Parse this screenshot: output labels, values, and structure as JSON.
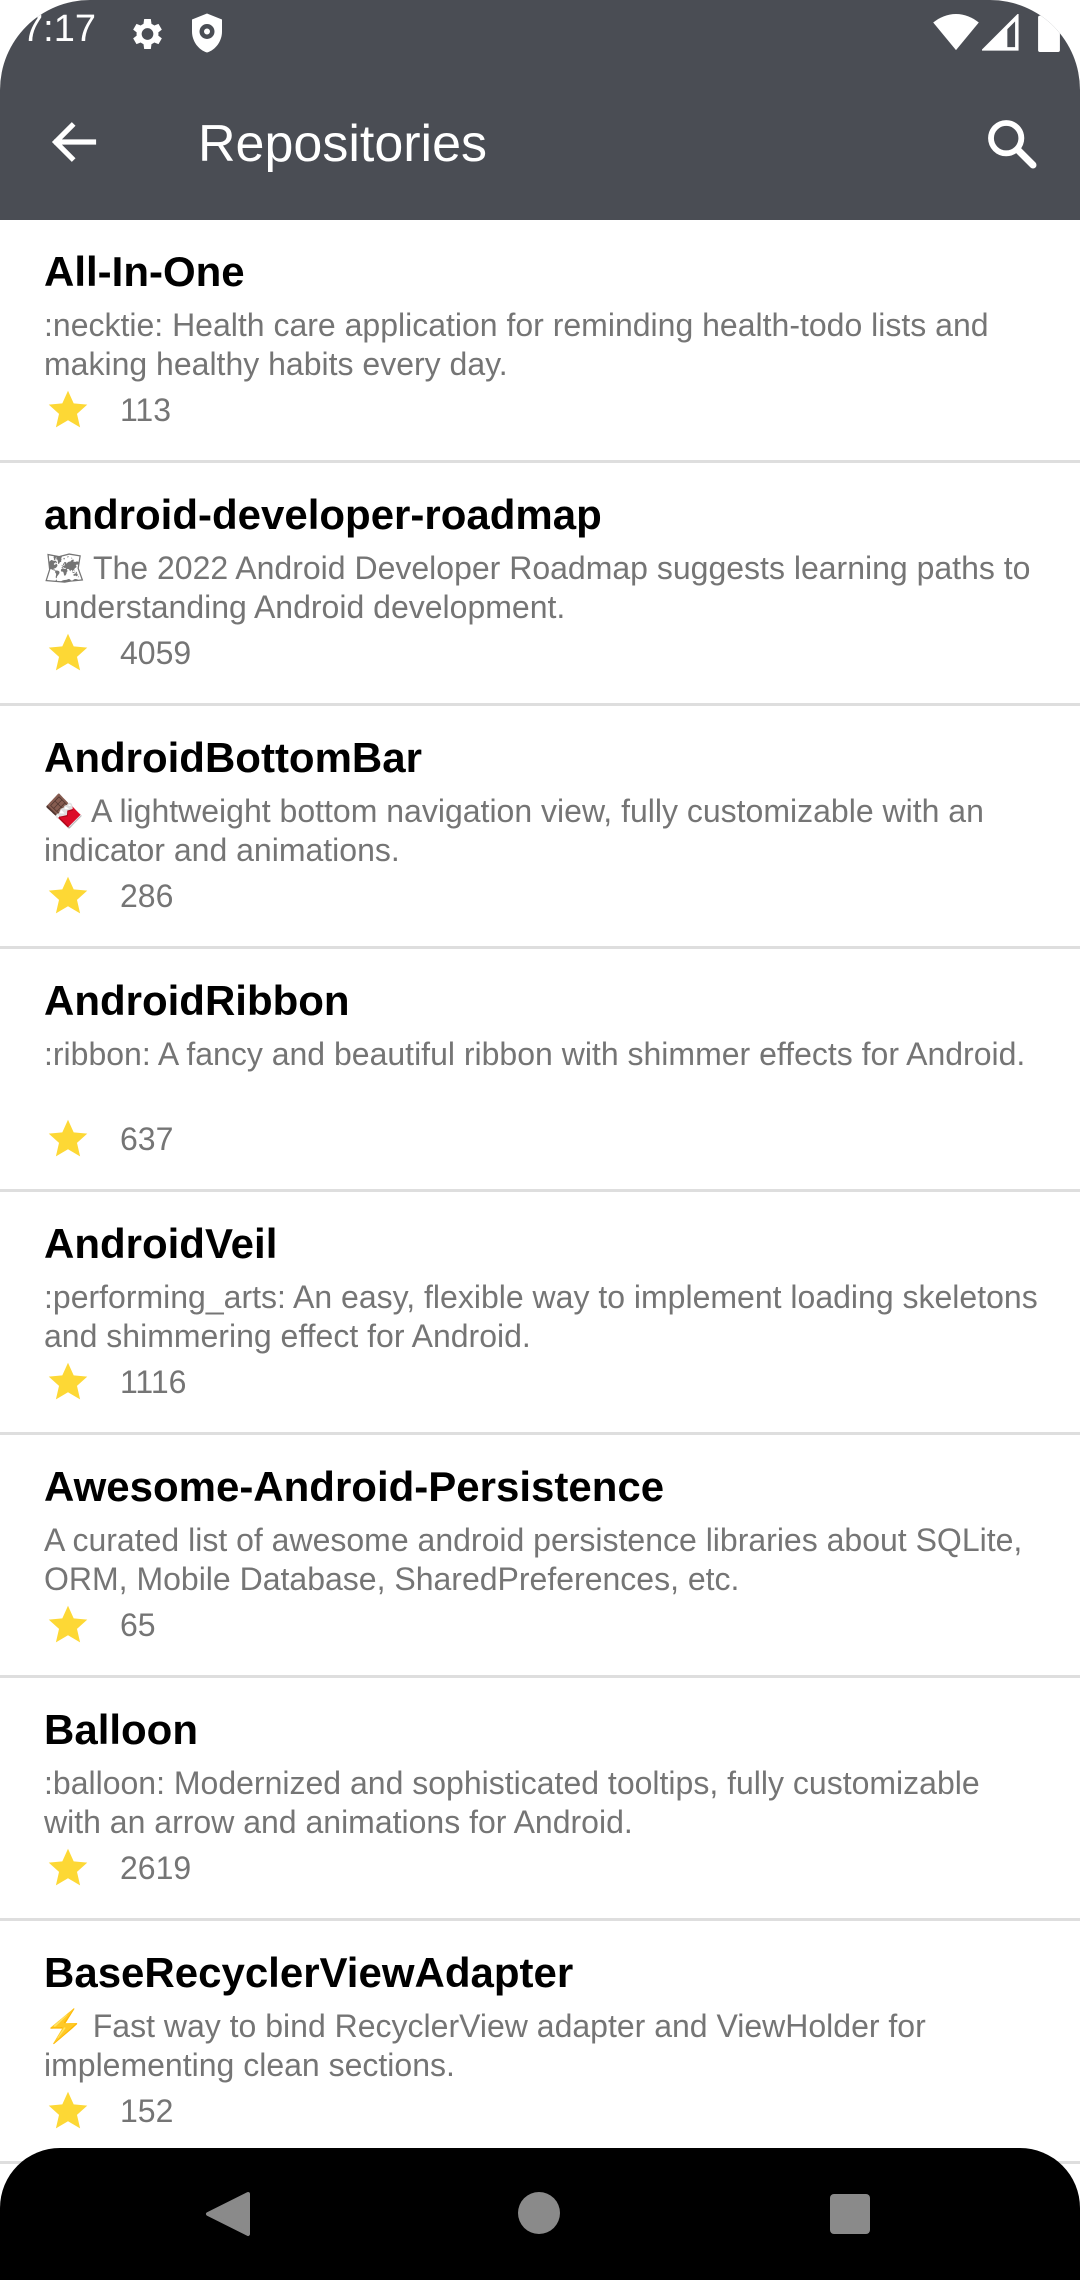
{
  "status_bar": {
    "time": "7:17"
  },
  "toolbar": {
    "title": "Repositories"
  },
  "repositories": [
    {
      "name": "All-In-One",
      "description": ":necktie: Health care application for reminding health-todo lists and making healthy habits every day.",
      "stars": "113"
    },
    {
      "name": "android-developer-roadmap",
      "description": "🗺 The 2022 Android Developer Roadmap suggests learning paths to understanding Android development.",
      "stars": "4059"
    },
    {
      "name": "AndroidBottomBar",
      "description": "🍫 A lightweight bottom navigation view, fully customizable with an indicator and animations.",
      "stars": "286"
    },
    {
      "name": "AndroidRibbon",
      "description": ":ribbon: A fancy and beautiful ribbon with shimmer effects for Android.",
      "stars": "637"
    },
    {
      "name": "AndroidVeil",
      "description": ":performing_arts: An easy, flexible way to implement loading skeletons and shimmering effect for Android.",
      "stars": "1116"
    },
    {
      "name": "Awesome-Android-Persistence",
      "description": "A curated list of awesome android persistence libraries about SQLite, ORM, Mobile Database, SharedPreferences, etc.",
      "stars": "65"
    },
    {
      "name": "Balloon",
      "description": ":balloon: Modernized and sophisticated tooltips, fully customizable with an arrow and animations for Android.",
      "stars": "2619"
    },
    {
      "name": "BaseRecyclerViewAdapter",
      "description": "⚡ Fast way to bind RecyclerView adapter and ViewHolder for implementing clean sections.",
      "stars": "152"
    }
  ],
  "icons": {
    "star": "star-icon",
    "back": "arrow-back-icon",
    "search": "search-icon"
  },
  "colors": {
    "app_bar": "#4a4d54",
    "star": "#fdd835",
    "secondary_text": "#757575",
    "divider": "#dedede"
  }
}
